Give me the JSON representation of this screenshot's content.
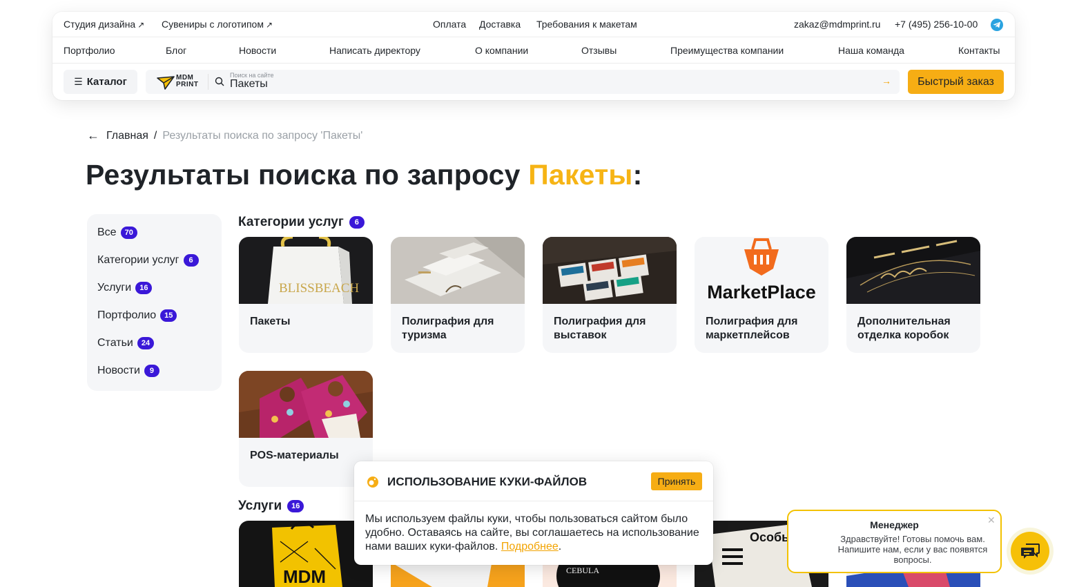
{
  "header": {
    "top_links": [
      {
        "label": "Студия дизайна",
        "icon": "arrow-up-right-icon"
      },
      {
        "label": "Сувениры с логотипом",
        "icon": "arrow-up-right-icon"
      }
    ],
    "center_links": [
      "Оплата",
      "Доставка",
      "Требования к макетам"
    ],
    "email": "zakaz@mdmprint.ru",
    "phone": "+7 (495) 256-10-00",
    "messenger_icon": "telegram-icon",
    "nav": [
      "Портфолио",
      "Блог",
      "Новости",
      "Написать директору",
      "О компании",
      "Отзывы",
      "Преимущества компании",
      "Наша команда",
      "Контакты"
    ],
    "catalog_label": "Каталог",
    "logo_text_1": "MDM",
    "logo_text_2": "PRINT",
    "search": {
      "label": "Поиск на сайте",
      "value": "Пакеты"
    },
    "quick_order_label": "Быстрый заказ"
  },
  "breadcrumb": {
    "home": "Главная",
    "separator": "/",
    "current": "Результаты поиска по запросу 'Пакеты'"
  },
  "title": {
    "prefix": "Результаты поиска по запросу ",
    "query": "Пакеты",
    "suffix": ":"
  },
  "filters": [
    {
      "label": "Все",
      "count": "70"
    },
    {
      "label": "Категории услуг",
      "count": "6"
    },
    {
      "label": "Услуги",
      "count": "16"
    },
    {
      "label": "Портфолио",
      "count": "15"
    },
    {
      "label": "Статьи",
      "count": "24"
    },
    {
      "label": "Новости",
      "count": "9"
    }
  ],
  "categories_section": {
    "title": "Категории услуг",
    "count": "6",
    "cards": [
      {
        "label": "Пакеты",
        "image": "white-gift-bag-photo"
      },
      {
        "label": "Полиграфия для туризма",
        "image": "brochures-photo"
      },
      {
        "label": "Полиграфия для выставок",
        "image": "catalogs-photo"
      },
      {
        "label": "Полиграфия для маркетплейсов",
        "image": "marketplace-logo"
      },
      {
        "label": "Дополнительная отделка коробок",
        "image": "embossed-box-photo"
      },
      {
        "label": "POS-материалы",
        "image": "door-hangers-photo"
      }
    ]
  },
  "marketplace_logo_text": "MarketPlace",
  "services_section": {
    "title": "Услуги",
    "count": "16"
  },
  "cookie": {
    "title": "ИСПОЛЬЗОВАНИЕ КУКИ-ФАЙЛОВ",
    "accept_label": "Принять",
    "text": "Мы используем файлы куки, чтобы пользоваться сайтом было удобно. Оставаясь на сайте, вы соглашаетесь на использование нами ваших куки-файлов.",
    "link_label": "Подробнее",
    "link_suffix": "."
  },
  "chat": {
    "title": "Менеджер",
    "text": "Здравствуйте! Готовы помочь вам. Напишите нам, если у вас появятся вопросы.",
    "close_icon": "close-icon",
    "button_icon": "chat-icon"
  },
  "colors": {
    "accent": "#f6ad14",
    "badge": "#3a18d8",
    "title_highlight": "#f6b415",
    "panel": "#f5f6f8"
  }
}
